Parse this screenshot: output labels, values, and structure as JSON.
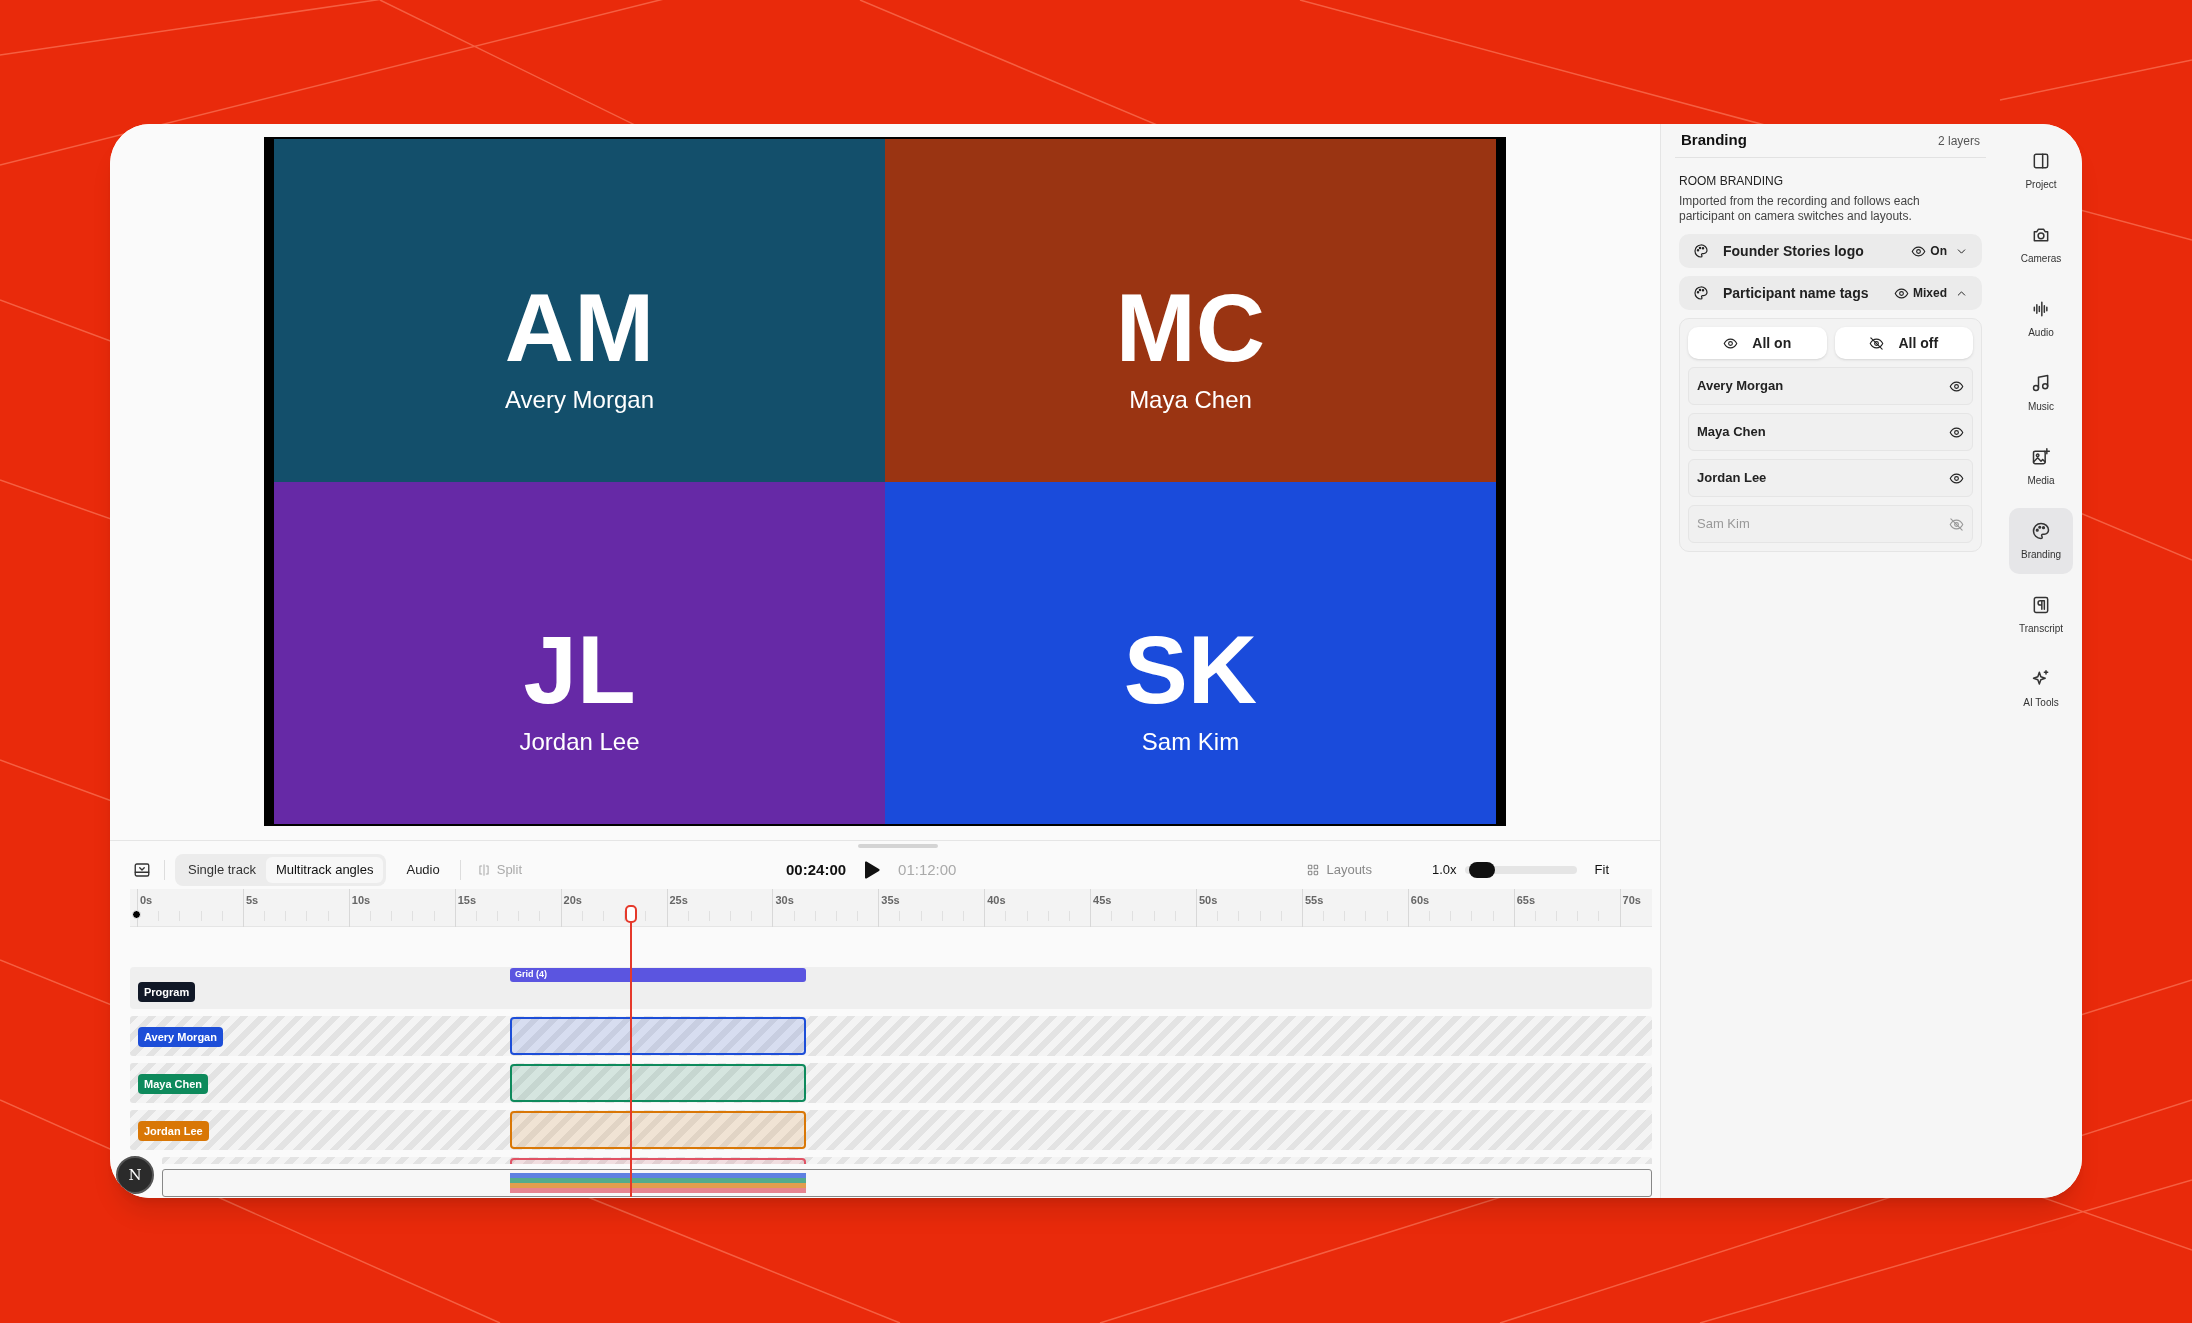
{
  "preview": {
    "tiles": [
      {
        "initials": "AM",
        "name": "Avery Morgan",
        "color": "#134f6b"
      },
      {
        "initials": "MC",
        "name": "Maya Chen",
        "color": "#9a3412"
      },
      {
        "initials": "JL",
        "name": "Jordan Lee",
        "color": "#6629a6"
      },
      {
        "initials": "SK",
        "name": "Sam Kim",
        "color": "#1a4bdb"
      }
    ]
  },
  "timeline": {
    "toolbar": {
      "modes": [
        {
          "label": "Single track",
          "selected": false
        },
        {
          "label": "Multitrack angles",
          "selected": true
        }
      ],
      "audio": "Audio",
      "split": "Split",
      "time": "00:24:00",
      "duration": "01:12:00",
      "layouts": "Layouts",
      "zoom": "1.0x",
      "zoom_slider": {
        "level": 0.05
      },
      "fit": "Fit"
    },
    "ruler": [
      "0s",
      "5s",
      "10s",
      "15s",
      "20s",
      "25s",
      "30s",
      "35s",
      "40s",
      "45s",
      "50s",
      "55s",
      "60s",
      "65s",
      "70s"
    ],
    "tracks": [
      {
        "kind": "program",
        "label": "Program",
        "color": "#111827",
        "clip": "Grid (4)"
      },
      {
        "kind": "camera",
        "label": "Avery Morgan",
        "color": "#1d4ed8"
      },
      {
        "kind": "camera",
        "label": "Maya Chen",
        "color": "#0e8a5c"
      },
      {
        "kind": "camera",
        "label": "Jordan Lee",
        "color": "#d97706"
      },
      {
        "kind": "camera",
        "color": "#e05264"
      }
    ]
  },
  "panel": {
    "title": "Branding",
    "count": "2 layers",
    "section": "ROOM BRANDING",
    "description": "Imported from the recording and follows each participant on camera switches and layouts.",
    "layers": [
      {
        "name": "Founder Stories logo",
        "status": "On",
        "expanded": false
      },
      {
        "name": "Participant name tags",
        "status": "Mixed",
        "expanded": true
      }
    ],
    "bulk": [
      "All on",
      "All off"
    ],
    "participants": [
      {
        "name": "Avery Morgan",
        "visible": true
      },
      {
        "name": "Maya Chen",
        "visible": true
      },
      {
        "name": "Jordan Lee",
        "visible": true
      },
      {
        "name": "Sam Kim",
        "visible": false
      }
    ]
  },
  "rail": [
    {
      "label": "Project",
      "selected": false
    },
    {
      "label": "Cameras",
      "selected": false
    },
    {
      "label": "Audio",
      "selected": false
    },
    {
      "label": "Music",
      "selected": false
    },
    {
      "label": "Media",
      "selected": false
    },
    {
      "label": "Branding",
      "selected": true
    },
    {
      "label": "Transcript",
      "selected": false
    },
    {
      "label": "AI Tools",
      "selected": false
    }
  ],
  "avatar": "N"
}
